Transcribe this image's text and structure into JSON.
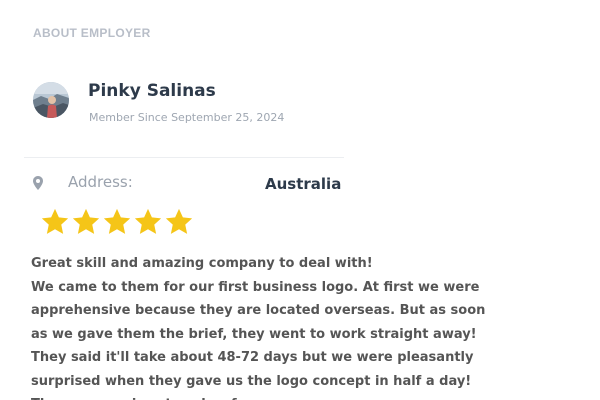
{
  "section": {
    "title": "ABOUT EMPLOYER"
  },
  "employer": {
    "name": "Pinky Salinas",
    "member_since": "Member Since September 25, 2024",
    "address_label": "Address:",
    "address_value": "Australia"
  },
  "review": {
    "rating": 5,
    "rating_max": 5,
    "headline": "Great skill and amazing company to deal with!",
    "body": "We came to them for our first business logo. At first we were apprehensive because they are located overseas. But as soon as we gave them the brief, they went to work straight away! They said it'll take about 48-72 days but we were pleasantly surprised when they gave us the logo concept in half a day! There were minor tweaks of ..."
  },
  "icons": {
    "location": "map-pin-icon",
    "star": "star-icon"
  },
  "colors": {
    "star": "#f5c518",
    "name_text": "#2d3a4a",
    "muted_text": "#9aa2ad",
    "review_text": "#555555"
  }
}
